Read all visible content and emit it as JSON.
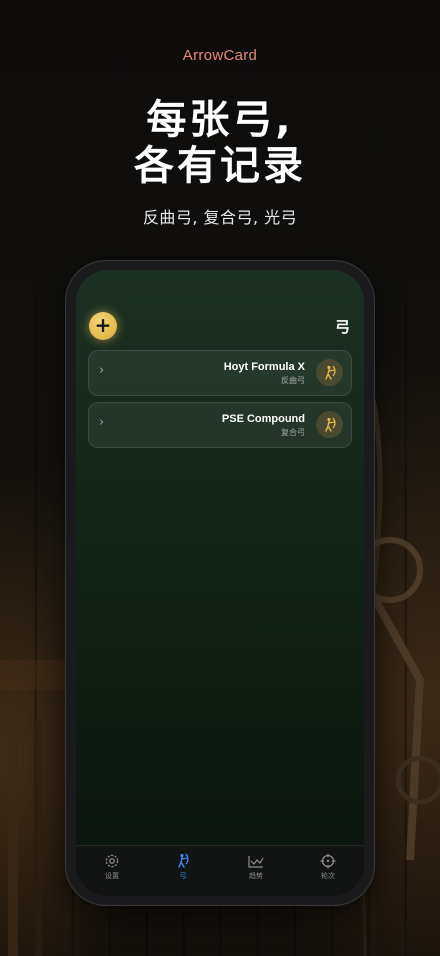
{
  "brand": "ArrowCard",
  "headline": {
    "line1": "每张弓,",
    "line2": "各有记录"
  },
  "subtitle": "反曲弓, 复合弓, 光弓",
  "screen": {
    "title": "弓",
    "add_label": "+",
    "bows": [
      {
        "name": "Hoyt Formula X",
        "type": "反曲弓",
        "icon": "archer-icon"
      },
      {
        "name": "PSE Compound",
        "type": "复合弓",
        "icon": "archer-icon"
      }
    ]
  },
  "tabs": [
    {
      "label": "设置",
      "icon": "gear-icon",
      "active": false
    },
    {
      "label": "弓",
      "icon": "archer-icon",
      "active": true
    },
    {
      "label": "趋势",
      "icon": "trend-chart-icon",
      "active": false
    },
    {
      "label": "轮次",
      "icon": "crosshair-icon",
      "active": false
    }
  ],
  "colors": {
    "brand": "#e7897c",
    "accent_gold": "#e5b94a",
    "active_tab": "#3a8cf0"
  }
}
